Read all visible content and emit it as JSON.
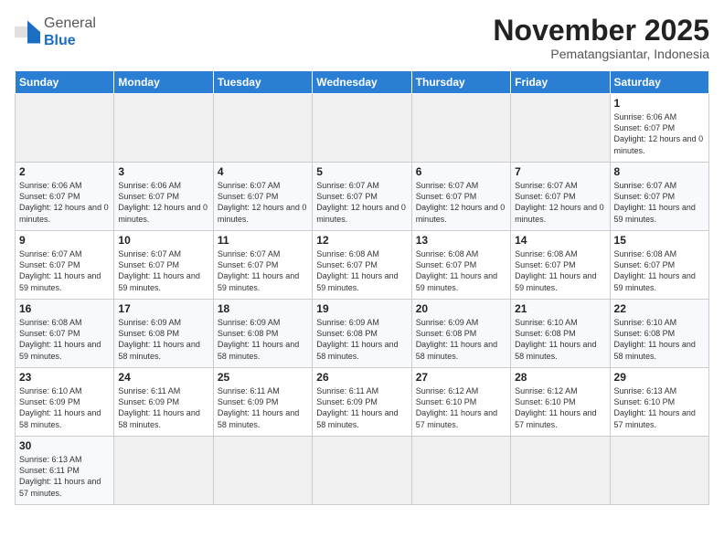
{
  "header": {
    "logo_general": "General",
    "logo_blue": "Blue",
    "month_year": "November 2025",
    "location": "Pematangsiantar, Indonesia"
  },
  "weekdays": [
    "Sunday",
    "Monday",
    "Tuesday",
    "Wednesday",
    "Thursday",
    "Friday",
    "Saturday"
  ],
  "days": {
    "d1": {
      "num": "1",
      "sunrise": "6:06 AM",
      "sunset": "6:07 PM",
      "daylight": "12 hours and 0 minutes."
    },
    "d2": {
      "num": "2",
      "sunrise": "6:06 AM",
      "sunset": "6:07 PM",
      "daylight": "12 hours and 0 minutes."
    },
    "d3": {
      "num": "3",
      "sunrise": "6:06 AM",
      "sunset": "6:07 PM",
      "daylight": "12 hours and 0 minutes."
    },
    "d4": {
      "num": "4",
      "sunrise": "6:07 AM",
      "sunset": "6:07 PM",
      "daylight": "12 hours and 0 minutes."
    },
    "d5": {
      "num": "5",
      "sunrise": "6:07 AM",
      "sunset": "6:07 PM",
      "daylight": "12 hours and 0 minutes."
    },
    "d6": {
      "num": "6",
      "sunrise": "6:07 AM",
      "sunset": "6:07 PM",
      "daylight": "12 hours and 0 minutes."
    },
    "d7": {
      "num": "7",
      "sunrise": "6:07 AM",
      "sunset": "6:07 PM",
      "daylight": "12 hours and 0 minutes."
    },
    "d8": {
      "num": "8",
      "sunrise": "6:07 AM",
      "sunset": "6:07 PM",
      "daylight": "11 hours and 59 minutes."
    },
    "d9": {
      "num": "9",
      "sunrise": "6:07 AM",
      "sunset": "6:07 PM",
      "daylight": "11 hours and 59 minutes."
    },
    "d10": {
      "num": "10",
      "sunrise": "6:07 AM",
      "sunset": "6:07 PM",
      "daylight": "11 hours and 59 minutes."
    },
    "d11": {
      "num": "11",
      "sunrise": "6:07 AM",
      "sunset": "6:07 PM",
      "daylight": "11 hours and 59 minutes."
    },
    "d12": {
      "num": "12",
      "sunrise": "6:08 AM",
      "sunset": "6:07 PM",
      "daylight": "11 hours and 59 minutes."
    },
    "d13": {
      "num": "13",
      "sunrise": "6:08 AM",
      "sunset": "6:07 PM",
      "daylight": "11 hours and 59 minutes."
    },
    "d14": {
      "num": "14",
      "sunrise": "6:08 AM",
      "sunset": "6:07 PM",
      "daylight": "11 hours and 59 minutes."
    },
    "d15": {
      "num": "15",
      "sunrise": "6:08 AM",
      "sunset": "6:07 PM",
      "daylight": "11 hours and 59 minutes."
    },
    "d16": {
      "num": "16",
      "sunrise": "6:08 AM",
      "sunset": "6:07 PM",
      "daylight": "11 hours and 59 minutes."
    },
    "d17": {
      "num": "17",
      "sunrise": "6:09 AM",
      "sunset": "6:08 PM",
      "daylight": "11 hours and 58 minutes."
    },
    "d18": {
      "num": "18",
      "sunrise": "6:09 AM",
      "sunset": "6:08 PM",
      "daylight": "11 hours and 58 minutes."
    },
    "d19": {
      "num": "19",
      "sunrise": "6:09 AM",
      "sunset": "6:08 PM",
      "daylight": "11 hours and 58 minutes."
    },
    "d20": {
      "num": "20",
      "sunrise": "6:09 AM",
      "sunset": "6:08 PM",
      "daylight": "11 hours and 58 minutes."
    },
    "d21": {
      "num": "21",
      "sunrise": "6:10 AM",
      "sunset": "6:08 PM",
      "daylight": "11 hours and 58 minutes."
    },
    "d22": {
      "num": "22",
      "sunrise": "6:10 AM",
      "sunset": "6:08 PM",
      "daylight": "11 hours and 58 minutes."
    },
    "d23": {
      "num": "23",
      "sunrise": "6:10 AM",
      "sunset": "6:09 PM",
      "daylight": "11 hours and 58 minutes."
    },
    "d24": {
      "num": "24",
      "sunrise": "6:11 AM",
      "sunset": "6:09 PM",
      "daylight": "11 hours and 58 minutes."
    },
    "d25": {
      "num": "25",
      "sunrise": "6:11 AM",
      "sunset": "6:09 PM",
      "daylight": "11 hours and 58 minutes."
    },
    "d26": {
      "num": "26",
      "sunrise": "6:11 AM",
      "sunset": "6:09 PM",
      "daylight": "11 hours and 58 minutes."
    },
    "d27": {
      "num": "27",
      "sunrise": "6:12 AM",
      "sunset": "6:10 PM",
      "daylight": "11 hours and 57 minutes."
    },
    "d28": {
      "num": "28",
      "sunrise": "6:12 AM",
      "sunset": "6:10 PM",
      "daylight": "11 hours and 57 minutes."
    },
    "d29": {
      "num": "29",
      "sunrise": "6:13 AM",
      "sunset": "6:10 PM",
      "daylight": "11 hours and 57 minutes."
    },
    "d30": {
      "num": "30",
      "sunrise": "6:13 AM",
      "sunset": "6:11 PM",
      "daylight": "11 hours and 57 minutes."
    }
  },
  "labels": {
    "sunrise": "Sunrise:",
    "sunset": "Sunset:",
    "daylight": "Daylight:"
  }
}
